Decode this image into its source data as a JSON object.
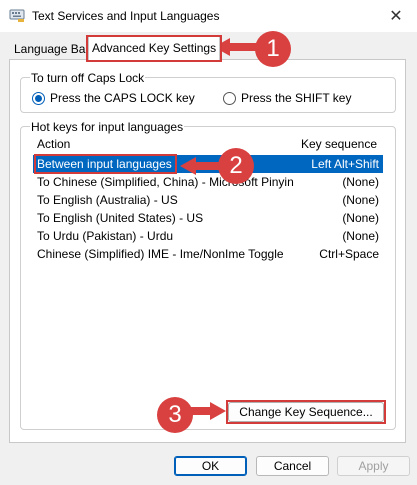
{
  "window": {
    "title": "Text Services and Input Languages",
    "close_glyph": "✕"
  },
  "tabs": [
    {
      "label": "Language Bar"
    },
    {
      "label": "Advanced Key Settings"
    }
  ],
  "caps_lock": {
    "label": "To turn off Caps Lock",
    "options": [
      {
        "label": "Press the CAPS LOCK key",
        "selected": true
      },
      {
        "label": "Press the SHIFT key",
        "selected": false
      }
    ]
  },
  "hotkeys": {
    "label": "Hot keys for input languages",
    "columns": {
      "action": "Action",
      "key": "Key sequence"
    },
    "rows": [
      {
        "action": "Between input languages",
        "key": "Left Alt+Shift"
      },
      {
        "action": "To Chinese (Simplified, China) - Microsoft Pinyin",
        "key": "(None)"
      },
      {
        "action": "To English (Australia) - US",
        "key": "(None)"
      },
      {
        "action": "To English (United States) - US",
        "key": "(None)"
      },
      {
        "action": "To Urdu (Pakistan) - Urdu",
        "key": "(None)"
      },
      {
        "action": "Chinese (Simplified) IME - Ime/NonIme Toggle",
        "key": "Ctrl+Space"
      }
    ],
    "change_button": "Change Key Sequence..."
  },
  "footer": {
    "ok": "OK",
    "cancel": "Cancel",
    "apply": "Apply"
  },
  "callouts": {
    "one": "1",
    "two": "2",
    "three": "3"
  },
  "colors": {
    "highlight": "#d33a3a",
    "selection": "#0067c0",
    "accent": "#005fb8"
  }
}
